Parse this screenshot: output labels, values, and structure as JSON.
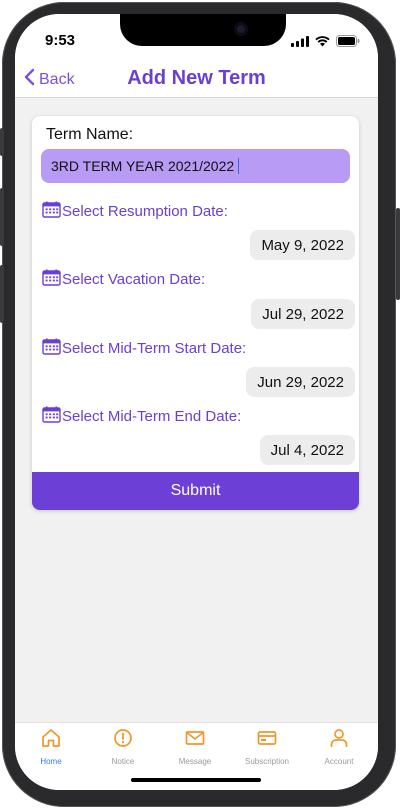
{
  "status_bar": {
    "time": "9:53"
  },
  "nav": {
    "back_label": "Back",
    "title": "Add New Term"
  },
  "form": {
    "term_name_label": "Term Name:",
    "term_name_value": "3RD TERM YEAR 2021/2022",
    "resumption": {
      "label": "Select Resumption Date:",
      "value": "May 9, 2022"
    },
    "vacation": {
      "label": "Select Vacation Date:",
      "value": "Jul 29, 2022"
    },
    "midterm_start": {
      "label": "Select Mid-Term Start Date:",
      "value": "Jun 29, 2022"
    },
    "midterm_end": {
      "label": "Select Mid-Term End Date:",
      "value": "Jul 4, 2022"
    },
    "submit_label": "Submit"
  },
  "tabs": {
    "home": "Home",
    "notice": "Notice",
    "message": "Message",
    "subscription": "Subscription",
    "account": "Account"
  },
  "colors": {
    "accent": "#6c3fd6",
    "input_bg": "#b79bf5",
    "tab_active": "#2f7bef",
    "tab_icon": "#f0962a"
  },
  "icons": {
    "back": "chevron-left-icon",
    "calendar": "calendar-icon",
    "home": "home-icon",
    "notice": "alert-circle-icon",
    "message": "mail-icon",
    "subscription": "credit-card-icon",
    "account": "person-icon"
  }
}
